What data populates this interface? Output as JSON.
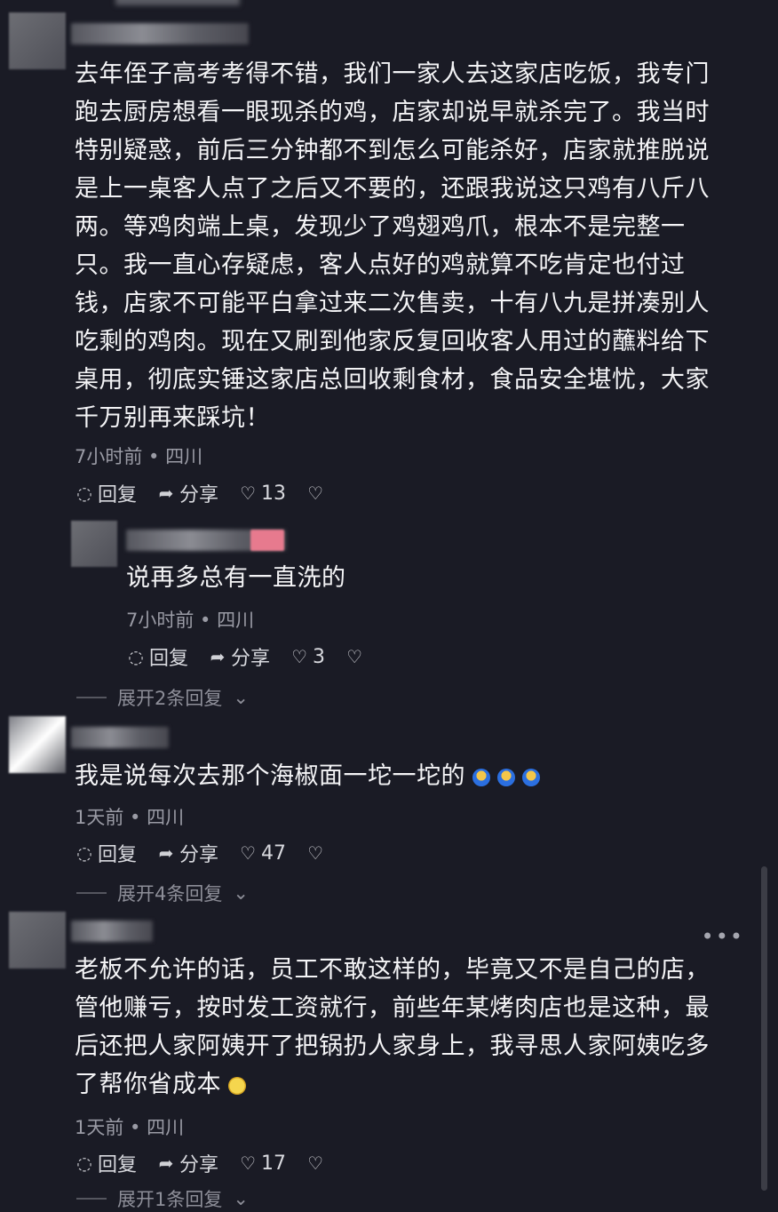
{
  "comments": [
    {
      "text": "去年侄子高考考得不错，我们一家人去这家店吃饭，我专门跑去厨房想看一眼现杀的鸡，店家却说早就杀完了。我当时特别疑惑，前后三分钟都不到怎么可能杀好，店家就推脱说是上一桌客人点了之后又不要的，还跟我说这只鸡有八斤八两。等鸡肉端上桌，发现少了鸡翅鸡爪，根本不是完整一只。我一直心存疑虑，客人点好的鸡就算不吃肯定也付过钱，店家不可能平白拿过来二次售卖，十有八九是拼凑别人吃剩的鸡肉。现在又刷到他家反复回收客人用过的蘸料给下桌用，彻底实锤这家店总回收剩食材，食品安全堪忧，大家千万别再来踩坑！",
      "meta": "7小时前 • 四川",
      "reply": "回复",
      "share": "分享",
      "likes": "13"
    },
    {
      "text": "说再多总有一直洗的",
      "meta": "7小时前 • 四川",
      "reply": "回复",
      "share": "分享",
      "likes": "3",
      "expand": "展开2条回复"
    },
    {
      "text": "我是说每次去那个海椒面一坨一坨的",
      "meta": "1天前 • 四川",
      "reply": "回复",
      "share": "分享",
      "likes": "47",
      "expand": "展开4条回复"
    },
    {
      "text": "老板不允许的话，员工不敢这样的，毕竟又不是自己的店，管他赚亏，按时发工资就行，前些年某烤肉店也是这种，最后还把人家阿姨开了把锅扔人家身上，我寻思人家阿姨吃多了帮你省成本",
      "meta": "1天前 • 四川",
      "reply": "回复",
      "share": "分享",
      "likes": "17",
      "expand": "展开1条回复"
    }
  ],
  "icons": {
    "reply": "comment-icon",
    "share": "share-icon",
    "like": "heart-icon",
    "dislike": "broken-heart-icon",
    "more": "more-icon"
  }
}
